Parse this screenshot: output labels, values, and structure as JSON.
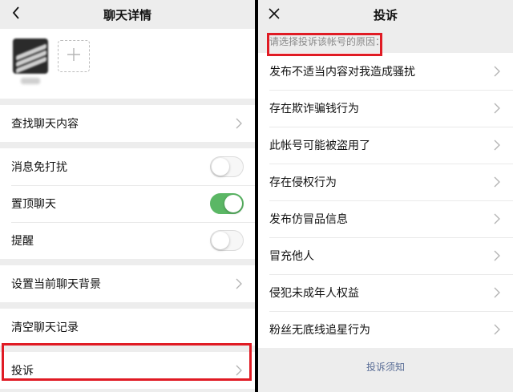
{
  "left": {
    "nav": {
      "title": "聊天详情"
    },
    "rows": {
      "find": "查找聊天内容",
      "mute": "消息免打扰",
      "pin": "置顶聊天",
      "remind": "提醒",
      "background": "设置当前聊天背景",
      "clear": "清空聊天记录",
      "complain": "投诉"
    },
    "toggles": {
      "mute": "off",
      "pin": "on",
      "remind": "off"
    }
  },
  "right": {
    "nav": {
      "title": "投诉"
    },
    "prompt": "请选择投诉该帐号的原因：",
    "reasons": [
      "发布不适当内容对我造成骚扰",
      "存在欺诈骗钱行为",
      "此帐号可能被盗用了",
      "存在侵权行为",
      "发布仿冒品信息",
      "冒充他人",
      "侵犯未成年人权益",
      "粉丝无底线追星行为"
    ],
    "footer_link": "投诉须知"
  },
  "colors": {
    "toggle_on": "#5bb765",
    "highlight": "#e01b24",
    "link": "#576b95"
  }
}
